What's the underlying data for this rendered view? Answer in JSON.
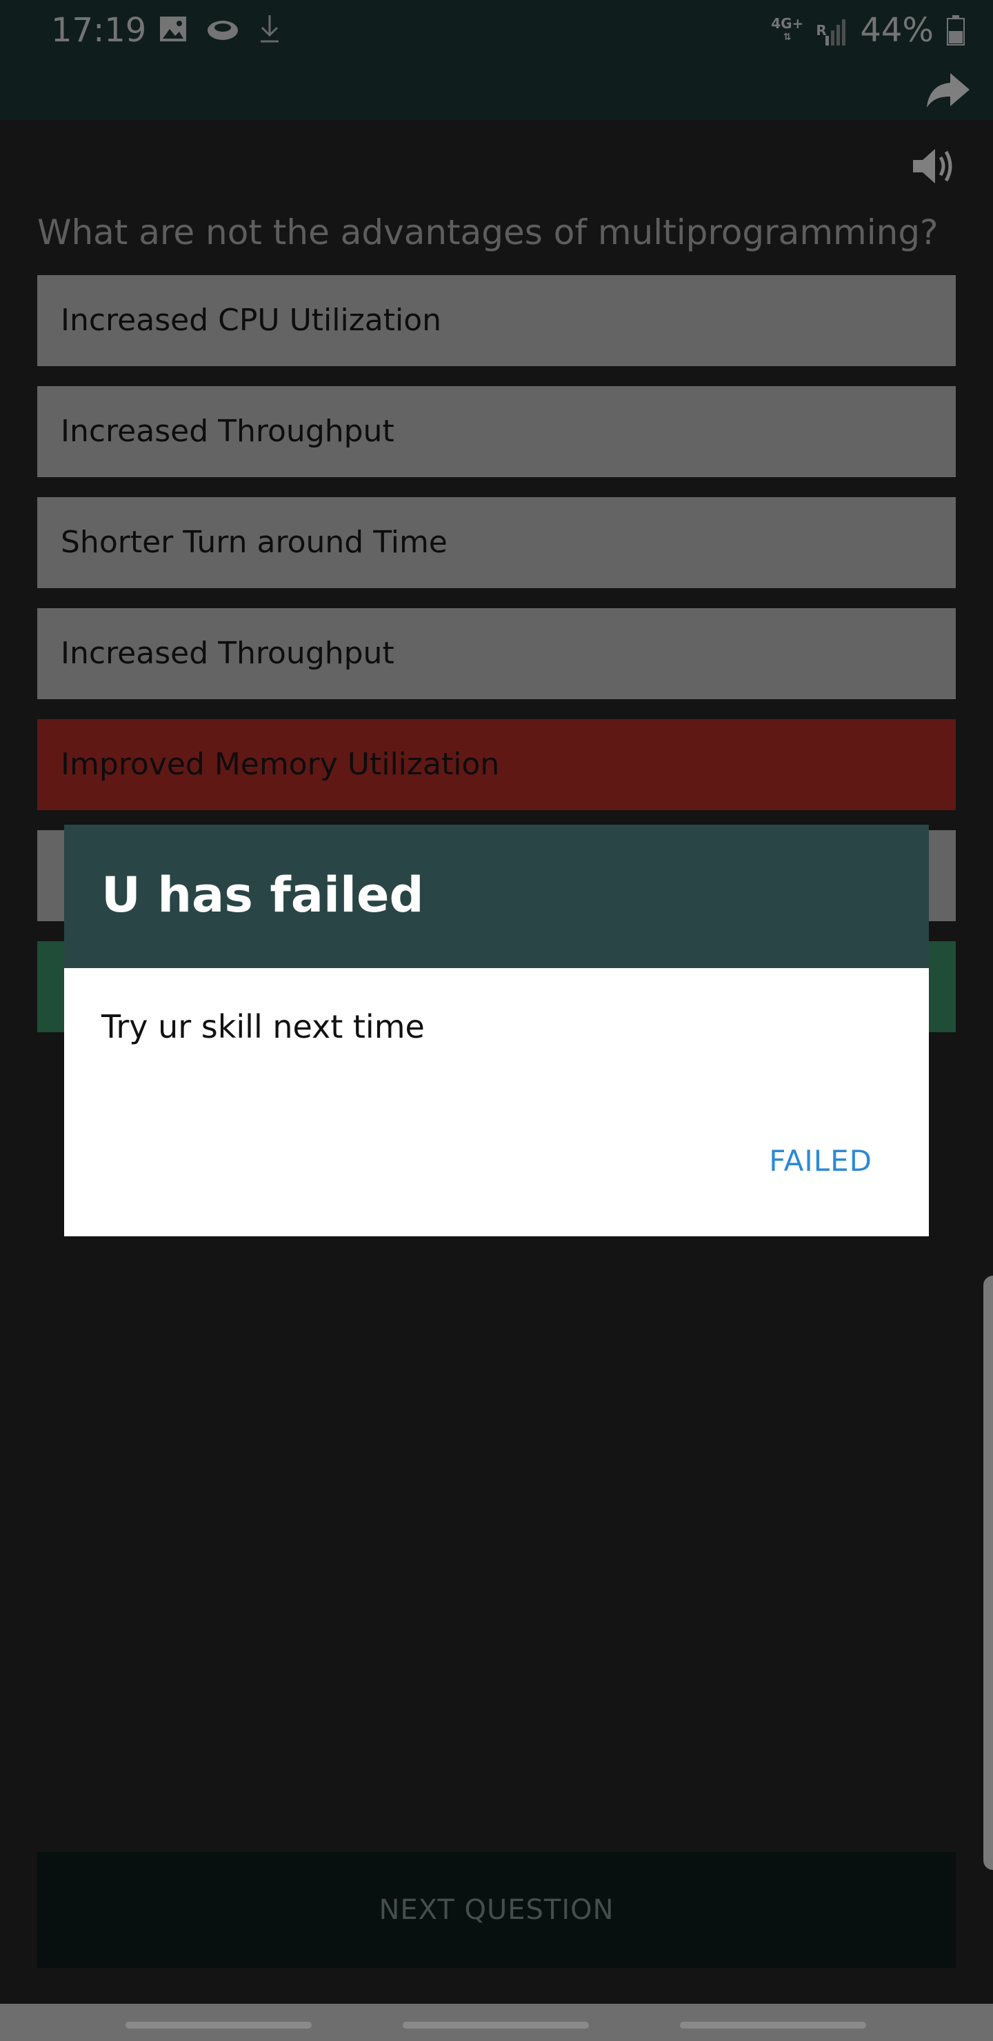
{
  "status_bar": {
    "time": "17:19",
    "network_line1": "4G+",
    "network_line2": "R",
    "battery": "44%",
    "icons": [
      "image-icon",
      "cloud-icon",
      "download-icon",
      "signal-icon",
      "battery-icon"
    ]
  },
  "app_bar": {
    "share_icon": "share-icon"
  },
  "quiz": {
    "sound_icon": "speaker-icon",
    "question": "What are not the advantages of multiprogramming?",
    "options": [
      {
        "label": "Increased CPU Utilization",
        "state": "neutral"
      },
      {
        "label": "Increased Throughput",
        "state": "neutral"
      },
      {
        "label": "Shorter Turn around Time",
        "state": "neutral"
      },
      {
        "label": "Increased Throughput",
        "state": "neutral"
      },
      {
        "label": "Improved Memory Utilization",
        "state": "wrong"
      },
      {
        "label": "",
        "state": "neutral"
      },
      {
        "label": "",
        "state": "correct"
      }
    ],
    "next_button": "NEXT QUESTION"
  },
  "dialog": {
    "title": "U has failed",
    "message": "Try ur skill next time",
    "button": "FAILED"
  },
  "colors": {
    "app_bar": "#1f3a3a",
    "wrong": "#c0302b",
    "correct": "#3e9a6e",
    "dialog_header": "#2a4545",
    "dialog_button": "#2d8ad6"
  }
}
